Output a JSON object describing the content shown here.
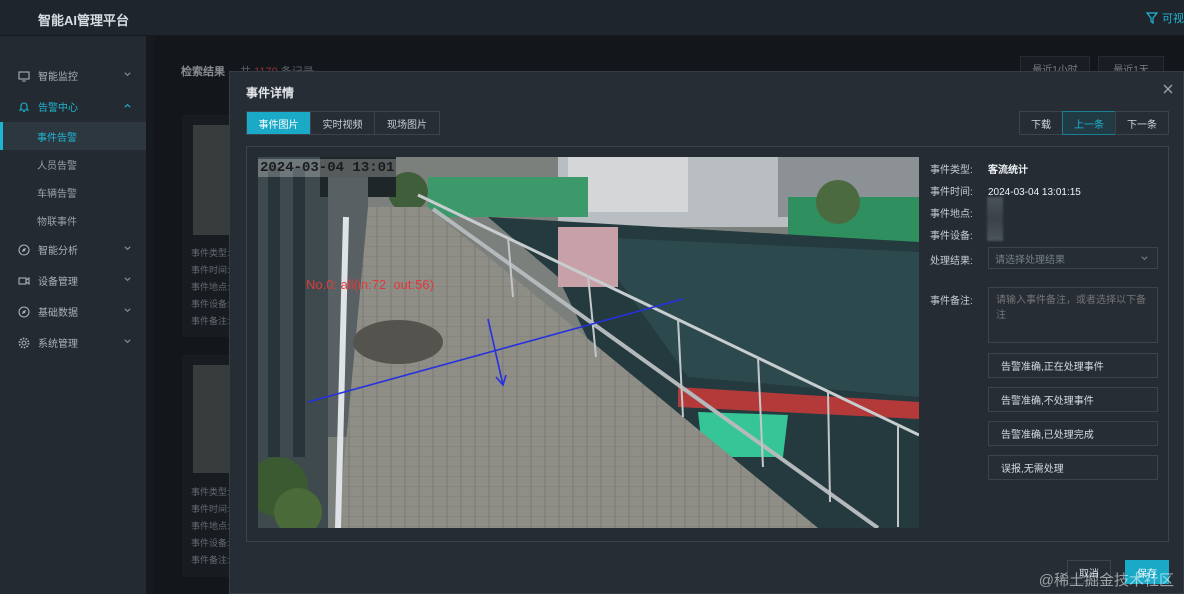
{
  "app": {
    "title": "智能AI管理平台",
    "top_right_label": "可视"
  },
  "sidebar": {
    "items": [
      {
        "label": "智能监控",
        "icon": "monitor-icon"
      },
      {
        "label": "告警中心",
        "icon": "bell-icon",
        "expanded": true,
        "children": [
          "事件告警",
          "人员告警",
          "车辆告警",
          "物联事件"
        ],
        "active_child": "事件告警"
      },
      {
        "label": "智能分析",
        "icon": "compass-icon"
      },
      {
        "label": "设备管理",
        "icon": "camera-icon"
      },
      {
        "label": "基础数据",
        "icon": "compass-icon"
      },
      {
        "label": "系统管理",
        "icon": "gear-icon"
      }
    ]
  },
  "background": {
    "results_label": "检索结果",
    "count_prefix": "共",
    "count_value": "1170",
    "count_suffix": "条记录",
    "filter_buttons": [
      "最近1小时",
      "最近1天"
    ],
    "card1_lines": [
      "事件类型:",
      "事件时间:",
      "事件地点:",
      "事件设备:",
      "事件备注:"
    ],
    "card2_lines": [
      "事件类型:",
      "事件时间:",
      "事件地点:",
      "事件设备:",
      "事件备注:"
    ]
  },
  "modal": {
    "title": "事件详情",
    "tabs": [
      "事件图片",
      "实时视频",
      "现场图片"
    ],
    "active_tab": "事件图片",
    "nav_buttons": {
      "download": "下载",
      "prev": "上一条",
      "next": "下一条"
    },
    "photo": {
      "timestamp": "2024-03-04 13:01",
      "overlay_label": "No.0: all(in:72  out:56)"
    },
    "details": {
      "type_label": "事件类型:",
      "type_value": "客流统计",
      "time_label": "事件时间:",
      "time_value": "2024-03-04 13:01:15",
      "location_label": "事件地点:",
      "device_label": "事件设备:",
      "result_label": "处理结果:",
      "result_placeholder": "请选择处理结果",
      "remark_label": "事件备注:",
      "remark_placeholder": "请输入事件备注，或者选择以下备注"
    },
    "actions": [
      "告警准确,正在处理事件",
      "告警准确,不处理事件",
      "告警准确,已处理完成",
      "误报,无需处理"
    ],
    "footer": {
      "cancel": "取消",
      "save": "保存"
    }
  },
  "watermark": "@稀土掘金技术社区",
  "colors": {
    "accent": "#1aa9c7",
    "alert_red": "#e24b4b"
  }
}
